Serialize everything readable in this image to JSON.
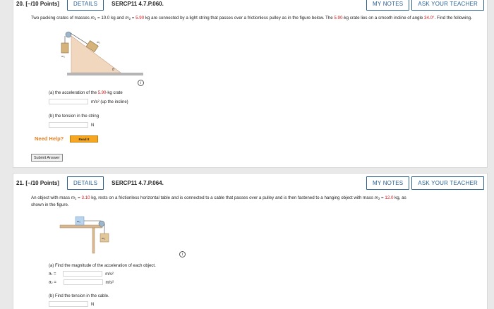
{
  "q20": {
    "number": "20.",
    "points": "[–/10 Points]",
    "details_label": "DETAILS",
    "code": "SERCP11 4.7.P.060.",
    "my_notes_label": "MY NOTES",
    "ask_label": "ASK YOUR TEACHER",
    "prose_1": "Two packing crates of masses ",
    "m1_sym": "m",
    "m1_sub": "1",
    "m1_val_text": " = 10.0 kg and ",
    "m2_sym": "m",
    "m2_sub": "2",
    "m2_eq": " = ",
    "m2_val": "5.90",
    "prose_2": " kg are connected by a light string that passes over a frictionless pulley as in the figure below. The ",
    "crate_val": "5.90",
    "prose_3": "-kg crate lies on a smooth incline of angle ",
    "angle_val": "34.0°",
    "prose_4": ". Find the following.",
    "fig_label_m1": "m₁",
    "fig_label_m2": "m₂",
    "fig_label_theta": "θ",
    "part_a_prefix": "(a) the acceleration of the ",
    "part_a_val": "5.90",
    "part_a_suffix": "-kg crate",
    "part_a_unit": "m/s² (up the incline)",
    "part_b_label": "(b) the tension in the string",
    "part_b_unit": "N",
    "need_help": "Need Help?",
    "read_it": "Read It",
    "submit_label": "Submit Answer",
    "info_glyph": "i"
  },
  "q21": {
    "number": "21.",
    "points": "[–/10 Points]",
    "details_label": "DETAILS",
    "code": "SERCP11 4.7.P.064.",
    "my_notes_label": "MY NOTES",
    "ask_label": "ASK YOUR TEACHER",
    "prose_1": "An object with mass ",
    "m1_sym": "m",
    "m1_sub": "1",
    "m1_eq": " = ",
    "m1_val": "3.10",
    "prose_2": " kg, rests on a frictionless horizontal table and is connected to a cable that passes over a pulley and is then fastened to a hanging object with mass ",
    "m2_sym": "m",
    "m2_sub": "2",
    "m2_eq": " = ",
    "m2_val": "12.0",
    "prose_3": " kg, as",
    "prose_4": "shown in the figure.",
    "fig_label_m1": "m₁",
    "fig_label_m2": "m₂",
    "part_a_label": "(a) Find the magnitude of the acceleration of each object.",
    "a1_label": "a₁ =",
    "a1_unit": "m/s²",
    "a2_label": "a₂ =",
    "a2_unit": "m/s²",
    "part_b_label": "(b) Find the tension in the cable.",
    "part_b_unit": "N",
    "info_glyph": "i"
  },
  "colors": {
    "accent": "#2b5f8f",
    "given_value": "#d0161a",
    "need_help": "#e67e22",
    "read_it": "#f5a623"
  }
}
